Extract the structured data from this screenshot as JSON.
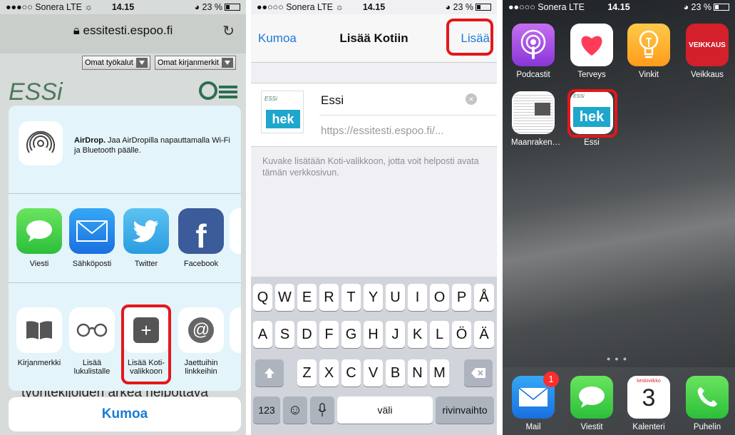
{
  "panel1": {
    "status": {
      "carrier": "●●●○○ Sonera  LTE ☼",
      "time": "14.15",
      "battery": "23 %"
    },
    "url": "essitesti.espoo.fi",
    "toolbar": {
      "tools": "Omat työkalut",
      "bookmarks": "Omat kirjanmerkit"
    },
    "logo": "ESSi",
    "background_text": "työntekijöiden arkea helpottava",
    "airdrop": {
      "title": "AirDrop.",
      "text": " Jaa AirDropilla napauttamalla Wi-Fi ja Bluetooth päälle."
    },
    "apps": [
      {
        "label": "Viesti"
      },
      {
        "label": "Sähköposti"
      },
      {
        "label": "Twitter"
      },
      {
        "label": "Facebook"
      }
    ],
    "actions": [
      {
        "label": "Kirjanmerkki"
      },
      {
        "label": "Lisää lukulistalle"
      },
      {
        "label": "Lisää Koti-valikkoon"
      },
      {
        "label": "Jaettuihin linkkeihin"
      }
    ],
    "cancel": "Kumoa"
  },
  "panel2": {
    "status": {
      "carrier": "●●○○○ Sonera  LTE ☼",
      "time": "14.15",
      "battery": "23 %"
    },
    "nav": {
      "cancel": "Kumoa",
      "title": "Lisää Kotiin",
      "add": "Lisää"
    },
    "thumb_text": "hek",
    "name": "Essi",
    "url": "https://essitesti.espoo.fi/...",
    "hint": "Kuvake lisätään Koti-valikkoon, jotta voit helposti avata tämän verkkosivun.",
    "keyboard": {
      "row1": [
        "Q",
        "W",
        "E",
        "R",
        "T",
        "Y",
        "U",
        "I",
        "O",
        "P",
        "Å"
      ],
      "row2": [
        "A",
        "S",
        "D",
        "F",
        "G",
        "H",
        "J",
        "K",
        "L",
        "Ö",
        "Ä"
      ],
      "row3": [
        "Z",
        "X",
        "C",
        "V",
        "B",
        "N",
        "M"
      ],
      "numbers": "123",
      "space": "väli",
      "return": "rivinvaihto"
    }
  },
  "panel3": {
    "status": {
      "carrier": "●●○○○ Sonera  LTE",
      "time": "14.15",
      "battery": "23 %"
    },
    "icons": [
      {
        "label": "Podcastit"
      },
      {
        "label": "Terveys"
      },
      {
        "label": "Vinkit"
      },
      {
        "label": "Veikkaus"
      },
      {
        "label": "Maanraken…"
      },
      {
        "label": "Essi"
      }
    ],
    "veikkaus_logo": "VEIKKAUS",
    "essi_icon_text": "hek",
    "dock": [
      {
        "label": "Mail",
        "badge": "1"
      },
      {
        "label": "Viestit"
      },
      {
        "label": "Kalenteri",
        "weekday": "keskiviikko",
        "day": "3"
      },
      {
        "label": "Puhelin"
      }
    ]
  }
}
